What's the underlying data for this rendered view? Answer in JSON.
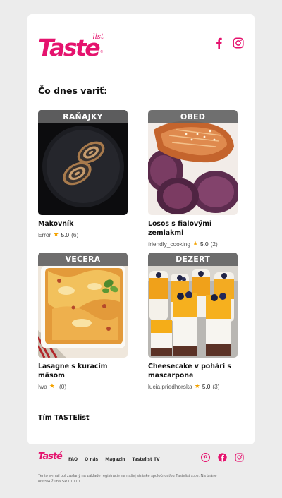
{
  "brand": {
    "logo_text": "Taste",
    "logo_sub": "list",
    "logo_reg": "®"
  },
  "heading": "Čo dnes variť:",
  "recipes": [
    {
      "category": "RAŇAJKY",
      "title": "Makovník",
      "author": "Error",
      "rating": "5.0",
      "count": "(6)"
    },
    {
      "category": "OBED",
      "title": "Losos s fialovými zemiakmi",
      "author": "friendly_cooking",
      "rating": "5.0",
      "count": "(2)"
    },
    {
      "category": "VEČERA",
      "title": "Lasagne s kuracím mäsom",
      "author": "Iwa",
      "rating": "",
      "count": "(0)"
    },
    {
      "category": "DEZERT",
      "title": "Cheesecake v pohári s mascarpone",
      "author": "lucia.priedhorska",
      "rating": "5.0",
      "count": "(3)"
    }
  ],
  "signoff": "Tím TASTElist",
  "footer": {
    "logo_text": "Tasté",
    "links": [
      "FAQ",
      "O nás",
      "Magazín",
      "Tastelist TV"
    ],
    "legal": "Tento e-mail bol zaslaný na základe registrácie na našej stránke spoločnosťou Tastelist s.r.o. Na bráne 8665/4 Žilina SR 010 01."
  },
  "colors": {
    "brand": "#e5136e",
    "star": "#f4a300",
    "category_bg": "#646464",
    "page_bg": "#ececec"
  },
  "icons": [
    "facebook-icon",
    "instagram-icon",
    "pinterest-icon",
    "star-icon"
  ]
}
